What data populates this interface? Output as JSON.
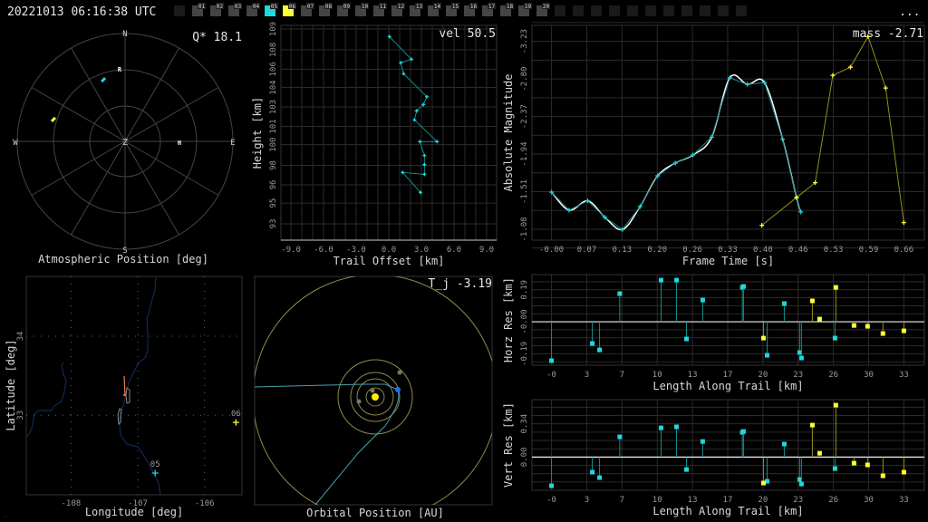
{
  "header": {
    "timestamp": "20221013 06:16:38 UTC",
    "more_label": "...",
    "stations": [
      {
        "label": "",
        "state": "empty"
      },
      {
        "label": "01",
        "state": "idle"
      },
      {
        "label": "02",
        "state": "idle"
      },
      {
        "label": "03",
        "state": "idle"
      },
      {
        "label": "04",
        "state": "idle"
      },
      {
        "label": "05",
        "state": "cyan"
      },
      {
        "label": "06",
        "state": "yellow"
      },
      {
        "label": "07",
        "state": "idle"
      },
      {
        "label": "08",
        "state": "idle"
      },
      {
        "label": "09",
        "state": "idle"
      },
      {
        "label": "10",
        "state": "idle"
      },
      {
        "label": "11",
        "state": "idle"
      },
      {
        "label": "12",
        "state": "idle"
      },
      {
        "label": "13",
        "state": "idle"
      },
      {
        "label": "14",
        "state": "idle"
      },
      {
        "label": "15",
        "state": "idle"
      },
      {
        "label": "16",
        "state": "idle"
      },
      {
        "label": "17",
        "state": "idle"
      },
      {
        "label": "18",
        "state": "idle"
      },
      {
        "label": "19",
        "state": "idle"
      },
      {
        "label": "20",
        "state": "idle"
      },
      {
        "label": "",
        "state": "empty"
      },
      {
        "label": "",
        "state": "empty"
      },
      {
        "label": "",
        "state": "empty"
      },
      {
        "label": "",
        "state": "empty"
      },
      {
        "label": "",
        "state": "empty"
      },
      {
        "label": "",
        "state": "empty"
      },
      {
        "label": "",
        "state": "empty"
      },
      {
        "label": "",
        "state": "empty"
      },
      {
        "label": "",
        "state": "empty"
      },
      {
        "label": "",
        "state": "empty"
      },
      {
        "label": "",
        "state": "empty"
      }
    ]
  },
  "colors": {
    "cyan": "#1fd8dc",
    "yellow": "#ffff33",
    "cyan_stem": "#168c8c",
    "yellow_stem": "#8f8f1e",
    "idle": "#444444",
    "empty": "#1a1a1a",
    "orbit": "#8a8a4a",
    "trajectory": "#4aa0b0",
    "earth": "#1f6fff",
    "sun": "#ffee00",
    "trail": "#f08040"
  },
  "chart_data": [
    {
      "type": "polar",
      "title": "Atmospheric Position [deg]",
      "annotation": "Q* 18.1",
      "cardinals": {
        "N": "N",
        "E": "E",
        "S": "S",
        "W": "W"
      },
      "center_label": "Z",
      "elevation_rings": [
        0,
        30,
        60
      ],
      "markers": [
        {
          "label": "R",
          "az": 355.7,
          "el": 29.5
        },
        {
          "label": "H",
          "az": 91,
          "el": 44.6
        }
      ],
      "tracks": [
        {
          "station": "05",
          "color": "cyan",
          "az": 340.6,
          "el": 35.5
        },
        {
          "station": "06",
          "color": "yellow",
          "az": 286.9,
          "el": 27.5
        }
      ]
    },
    {
      "type": "line",
      "xlabel": "Trail Offset [km]",
      "ylabel": "Height [km]",
      "annotation": "vel 50.5",
      "xlim": [
        -9.92,
        9.92
      ],
      "ylim": [
        91.66,
        109.3
      ],
      "x_tick_values": [
        -9,
        -6,
        -3,
        0,
        3,
        6,
        9
      ],
      "x_tick_labels": [
        "-9.0",
        "-6.0",
        "-3.0",
        "0.0",
        "3.0",
        "6.0",
        "9.0"
      ],
      "y_tick_values": [
        109.0,
        107.3,
        105.7,
        104.2,
        102.6,
        101.0,
        99.5,
        97.8,
        96.2,
        94.7,
        93.0
      ],
      "y_tick_labels": [
        "109",
        "108",
        "106",
        "104",
        "103",
        "101",
        "100",
        "98",
        "96",
        "95",
        "93"
      ],
      "series": [
        {
          "name": "trail",
          "color": "cyan",
          "x": [
            0.06,
            2.08,
            1.11,
            1.36,
            3.5,
            3.19,
            2.56,
            2.36,
            4.44,
            2.86,
            3.28,
            3.28,
            3.28,
            1.28,
            2.92
          ],
          "y": [
            108.38,
            106.52,
            106.23,
            105.33,
            103.44,
            102.8,
            102.28,
            101.54,
            99.75,
            99.75,
            98.61,
            97.86,
            97.07,
            97.22,
            95.58
          ]
        }
      ]
    },
    {
      "type": "line",
      "xlabel": "Frame Time [s]",
      "ylabel": "Absolute Magnitude",
      "annotation": "mass -2.71",
      "xlim": [
        -0.0366,
        0.6985
      ],
      "ylim": [
        -3.413,
        -0.955
      ],
      "y_inverted": true,
      "x_tick_values": [
        0,
        0.066,
        0.132,
        0.198,
        0.264,
        0.33,
        0.396,
        0.462,
        0.528,
        0.594,
        0.66
      ],
      "x_tick_labels": [
        "-0.00",
        "0.07",
        "0.13",
        "0.20",
        "0.26",
        "0.33",
        "0.40",
        "0.46",
        "0.53",
        "0.59",
        "0.66"
      ],
      "y_tick_values": [
        -3.23,
        -2.8,
        -2.37,
        -1.94,
        -1.51,
        -1.08
      ],
      "y_tick_labels": [
        "-3.23",
        "-2.80",
        "-2.37",
        "-1.94",
        "-1.51",
        "-1.08"
      ],
      "series": [
        {
          "name": "station 05",
          "color": "cyan",
          "smooth_fit": true,
          "x": [
            0,
            0.033,
            0.068,
            0.1,
            0.133,
            0.166,
            0.199,
            0.232,
            0.265,
            0.3,
            0.334,
            0.367,
            0.399,
            0.433,
            0.459,
            0.467
          ],
          "y": [
            -1.505,
            -1.298,
            -1.405,
            -1.216,
            -1.077,
            -1.34,
            -1.692,
            -1.837,
            -1.93,
            -2.133,
            -2.813,
            -2.737,
            -2.758,
            -2.109,
            -1.443,
            -1.278
          ]
        },
        {
          "name": "station 06",
          "color": "yellow",
          "x": [
            0.394,
            0.459,
            0.494,
            0.527,
            0.56,
            0.593,
            0.626,
            0.66
          ],
          "y": [
            -1.125,
            -1.443,
            -1.612,
            -2.841,
            -2.934,
            -3.286,
            -2.696,
            -1.156
          ]
        }
      ]
    },
    {
      "type": "scatter",
      "subtype": "stem",
      "xlabel": "Length Along Trail [km]",
      "ylabel": "Horz Res [km]",
      "xlim": [
        -1.83,
        34.92
      ],
      "ylim": [
        -0.258,
        0.28
      ],
      "x_tick_values": [
        0,
        3.3,
        6.6,
        9.9,
        13.2,
        16.5,
        19.8,
        23.1,
        26.4,
        29.7,
        33.0
      ],
      "x_tick_labels": [
        "-0",
        "3",
        "7",
        "10",
        "13",
        "17",
        "20",
        "23",
        "26",
        "30",
        "33"
      ],
      "y_tick_values": [
        0.19,
        0.0,
        -0.19
      ],
      "y_tick_labels": [
        "0.19",
        "-0.00",
        "-0.19"
      ],
      "series": [
        {
          "name": "station 05",
          "color": "cyan",
          "x": [
            0,
            3.82,
            4.5,
            6.39,
            10.26,
            11.71,
            12.64,
            14.16,
            17.87,
            17.98,
            20.19,
            21.8,
            23.24,
            23.41,
            26.55
          ],
          "y": [
            -0.231,
            -0.129,
            -0.167,
            0.167,
            0.247,
            0.247,
            -0.102,
            0.129,
            0.204,
            0.21,
            -0.199,
            0.108,
            -0.183,
            -0.215,
            -0.097
          ]
        },
        {
          "name": "station 06",
          "color": "yellow",
          "x": [
            19.85,
            24.43,
            25.11,
            26.63,
            28.33,
            29.6,
            31.04,
            33.0
          ],
          "y": [
            -0.097,
            0.124,
            0.016,
            0.204,
            -0.022,
            -0.027,
            -0.07,
            -0.054
          ]
        }
      ]
    },
    {
      "type": "scatter",
      "subtype": "stem",
      "xlabel": "Length Along Trail [km]",
      "ylabel": "Vert Res [km]",
      "xlim": [
        -1.83,
        34.92
      ],
      "ylim": [
        -0.339,
        0.587
      ],
      "x_tick_values": [
        0,
        3.3,
        6.6,
        9.9,
        13.2,
        16.5,
        19.8,
        23.1,
        26.4,
        29.7,
        33.0
      ],
      "x_tick_labels": [
        "-0",
        "3",
        "7",
        "10",
        "13",
        "17",
        "20",
        "23",
        "26",
        "30",
        "33"
      ],
      "y_tick_values": [
        0.34,
        0.0
      ],
      "y_tick_labels": [
        "0.34",
        "0.00"
      ],
      "series": [
        {
          "name": "station 05",
          "color": "cyan",
          "x": [
            0,
            3.82,
            4.5,
            6.39,
            10.26,
            11.71,
            12.64,
            14.16,
            17.87,
            17.98,
            20.19,
            21.8,
            23.24,
            23.41,
            26.55
          ],
          "y": [
            -0.293,
            -0.154,
            -0.21,
            0.207,
            0.299,
            0.309,
            -0.127,
            0.16,
            0.253,
            0.262,
            -0.247,
            0.133,
            -0.228,
            -0.275,
            -0.117
          ]
        },
        {
          "name": "station 06",
          "color": "yellow",
          "x": [
            19.85,
            24.43,
            25.11,
            26.63,
            28.33,
            29.6,
            31.04,
            33.0
          ],
          "y": [
            -0.265,
            0.327,
            0.04,
            0.531,
            -0.062,
            -0.08,
            -0.191,
            -0.154
          ]
        }
      ]
    },
    {
      "type": "map",
      "xlabel": "Longitude [deg]",
      "ylabel": "Latitude [deg]",
      "xlim": [
        -108.67,
        -105.44
      ],
      "ylim": [
        31.995,
        34.756
      ],
      "x_tick_values": [
        -108,
        -107,
        -106
      ],
      "x_tick_labels": [
        "-108",
        "-107",
        "-106"
      ],
      "y_tick_values": [
        34,
        33
      ],
      "y_tick_labels": [
        "34",
        "33"
      ],
      "stations": [
        {
          "label": "05",
          "lon": -106.74,
          "lat": 32.27,
          "color": "cyan"
        },
        {
          "label": "06",
          "lon": -105.53,
          "lat": 32.91,
          "color": "yellow"
        }
      ]
    },
    {
      "type": "orbit",
      "title": "Orbital Position [AU]",
      "annotation": "T_j -3.19"
    }
  ]
}
